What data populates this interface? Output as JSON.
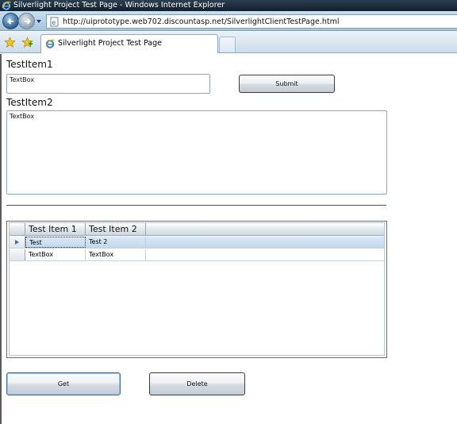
{
  "window": {
    "title": "Silverlight Project Test Page - Windows Internet Explorer",
    "url": "http://uiprototype.web702.discountasp.net/SilverlightClientTestPage.html"
  },
  "tabs": [
    {
      "label": "Silverlight Project Test Page",
      "active": true
    }
  ],
  "form": {
    "item1_label": "TestItem1",
    "item1_value": "TextBox",
    "submit_label": "Submit",
    "item2_label": "TestItem2",
    "item2_value": "TextBox"
  },
  "grid": {
    "columns": [
      "Test Item 1",
      "Test Item 2"
    ],
    "rows": [
      {
        "col1": "Test",
        "col2": "Test 2",
        "selected": true
      },
      {
        "col1": "TextBox",
        "col2": "TextBox",
        "selected": false
      }
    ]
  },
  "actions": {
    "get_label": "Get",
    "delete_label": "Delete"
  },
  "icons": {
    "ie": "internet-explorer-icon",
    "back": "back-arrow-icon",
    "forward": "forward-arrow-icon",
    "favorites": "favorites-star-icon",
    "add_favorites": "add-favorites-icon"
  },
  "colors": {
    "titlebar": "#1b2a38",
    "selected_row": "#c3d8ee",
    "row_indicator": "#3d6fa5"
  }
}
